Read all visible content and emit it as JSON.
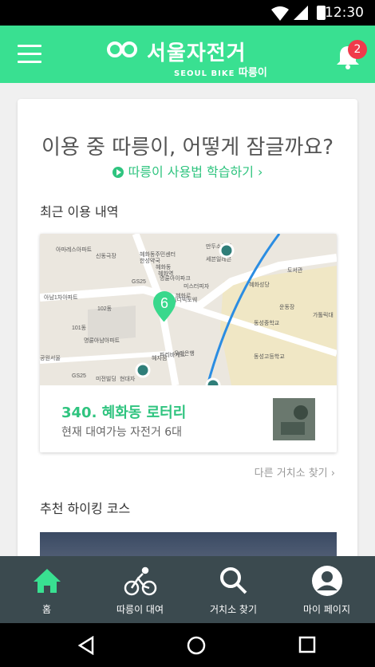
{
  "status_bar": {
    "time": "12:30"
  },
  "app_bar": {
    "brand": "서울자전거",
    "brand_sub": "SEOUL BIKE",
    "brand_sub_kr": "따릉이",
    "notification_count": "2",
    "accent_color": "#39e091"
  },
  "main": {
    "headline": "이용 중 따릉이, 어떻게 잠글까요?",
    "howto_link": "따릉이 사용법 학습하기",
    "recent_title": "최근 이용 내역",
    "map": {
      "labels": [
        "아마레스아파트",
        "신동극장",
        "혜화동주민센터",
        "한성약국",
        "혜화동",
        "혜화역",
        "GS25",
        "명륜아이파크",
        "미스터피자",
        "혜화로",
        "아남1차아파트",
        "102동",
        "101동",
        "명륜아남아파트",
        "공원서울",
        "GS25",
        "미전빌딩",
        "현대자",
        "혜자점",
        "우리은행",
        "파리바게트",
        "비디빅토웨",
        "만두소국집",
        "세븐일레븐",
        "혜화성당",
        "도서관",
        "운동장",
        "동성중학교",
        "동성고등학교",
        "가톨릭대"
      ],
      "cluster_count": "6"
    },
    "station": {
      "name": "340. 혜화동 로터리",
      "availability": "현재 대여가능 자전거 6대"
    },
    "other_stations_link": "다른 거치소 찾기",
    "hiking_title": "추천 하이킹 코스"
  },
  "bottom_nav": {
    "items": [
      {
        "label": "홈",
        "icon": "home-icon",
        "active": true
      },
      {
        "label": "따릉이 대여",
        "icon": "bicycle-icon",
        "active": false
      },
      {
        "label": "거치소 찾기",
        "icon": "search-icon",
        "active": false
      },
      {
        "label": "마이 페이지",
        "icon": "account-icon",
        "active": false
      }
    ]
  }
}
